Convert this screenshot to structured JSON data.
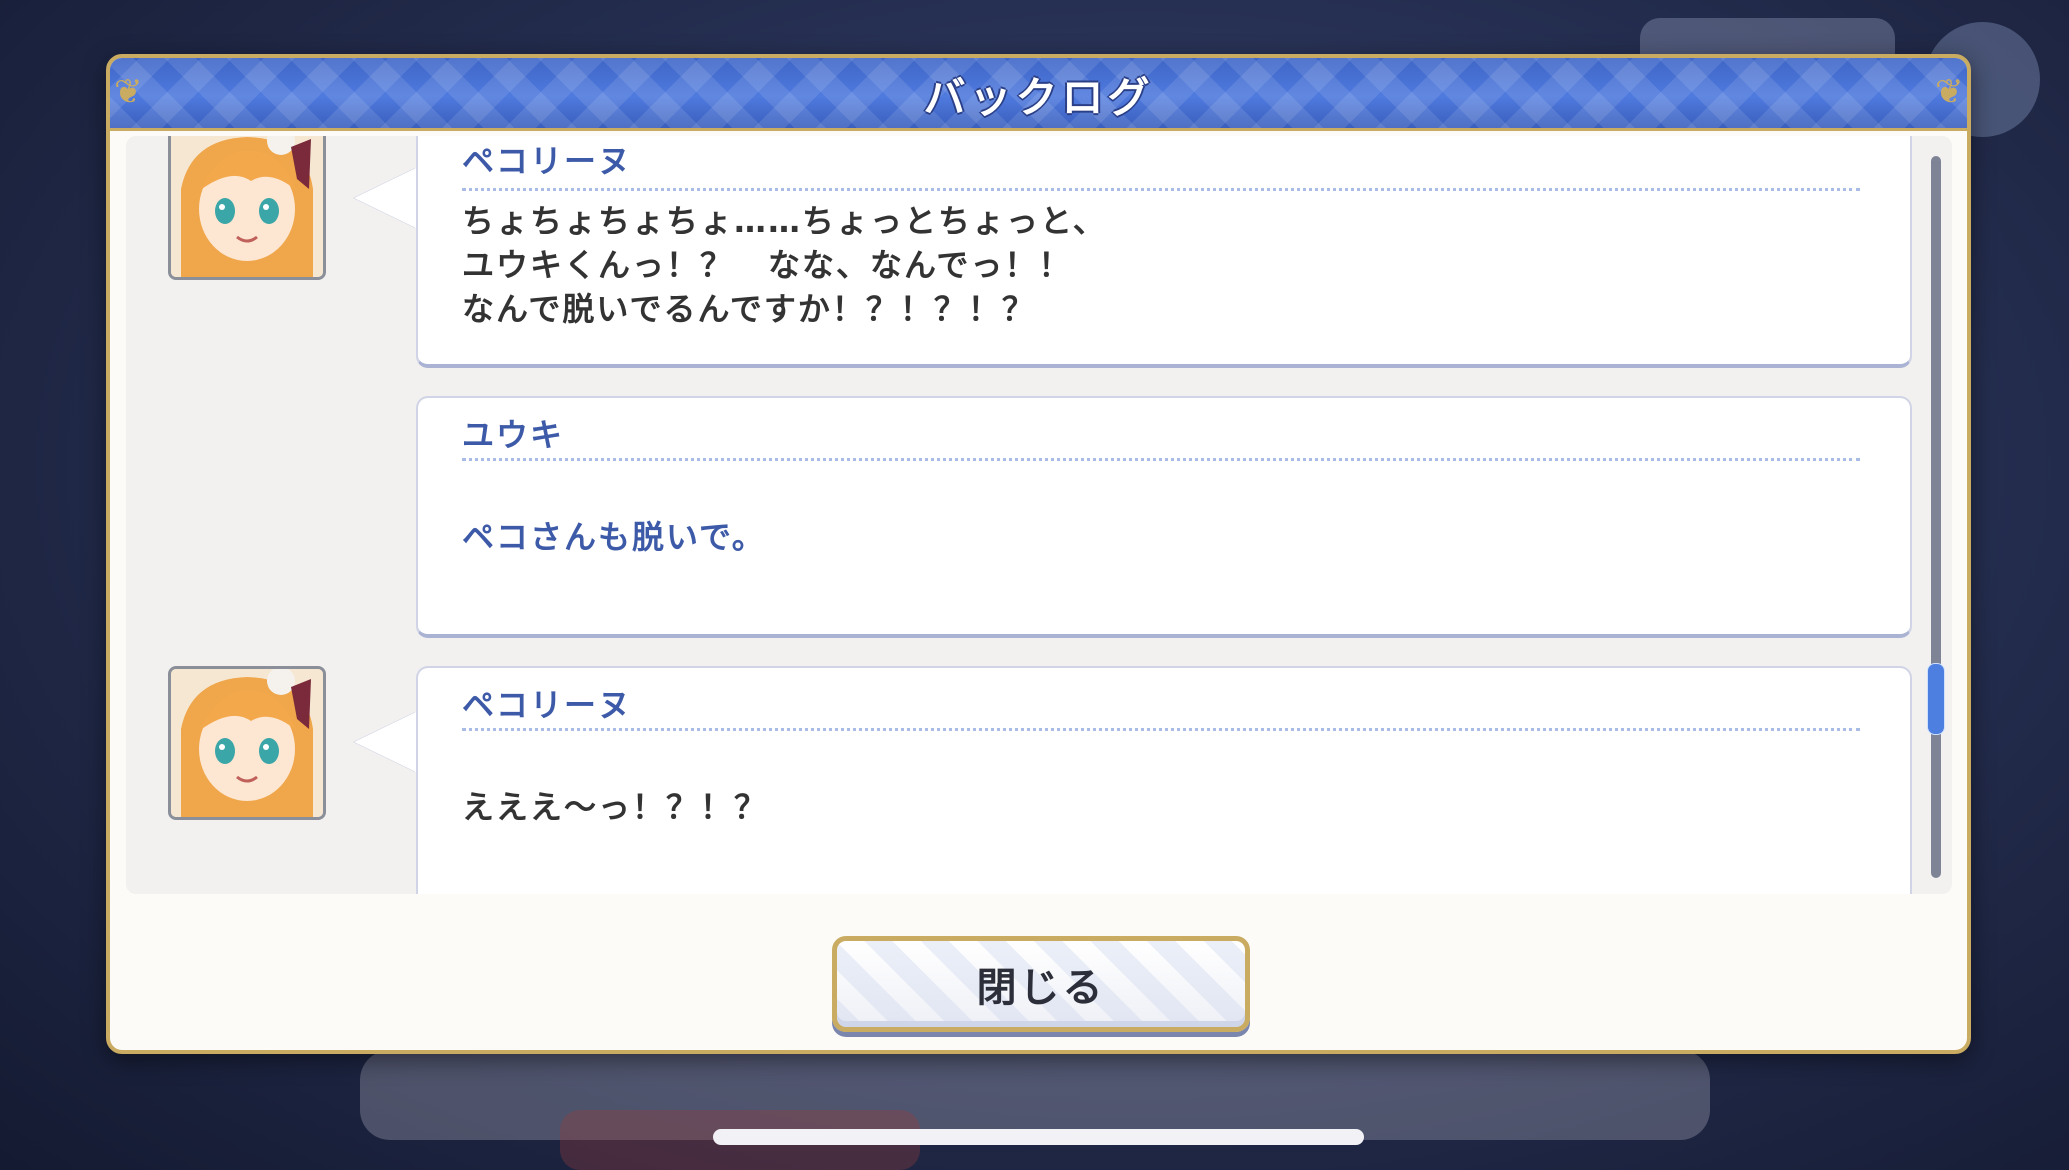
{
  "window": {
    "title": "バックログ"
  },
  "entries": [
    {
      "speaker": "ペコリーヌ",
      "has_avatar": true,
      "lines": [
        "ちょちょちょちょ……ちょっとちょっと、",
        "ユウキくんっ！？　なな、なんでっ！！",
        "なんで脱いでるんですか！？！？！？"
      ]
    },
    {
      "speaker": "ユウキ",
      "has_avatar": false,
      "lines": [
        "ペコさんも脱いで。"
      ]
    },
    {
      "speaker": "ペコリーヌ",
      "has_avatar": true,
      "lines": [
        "えええ～っ！？！？"
      ]
    }
  ],
  "footer": {
    "close_label": "閉じる"
  },
  "scroll": {
    "position_fraction": 0.78
  },
  "colors": {
    "header_blue": "#4f7ade",
    "gold_border": "#c9ab61",
    "speaker_blue": "#3d5aa8"
  },
  "icons": {
    "avatar": "character-portrait",
    "corner": "gold-ornament"
  }
}
